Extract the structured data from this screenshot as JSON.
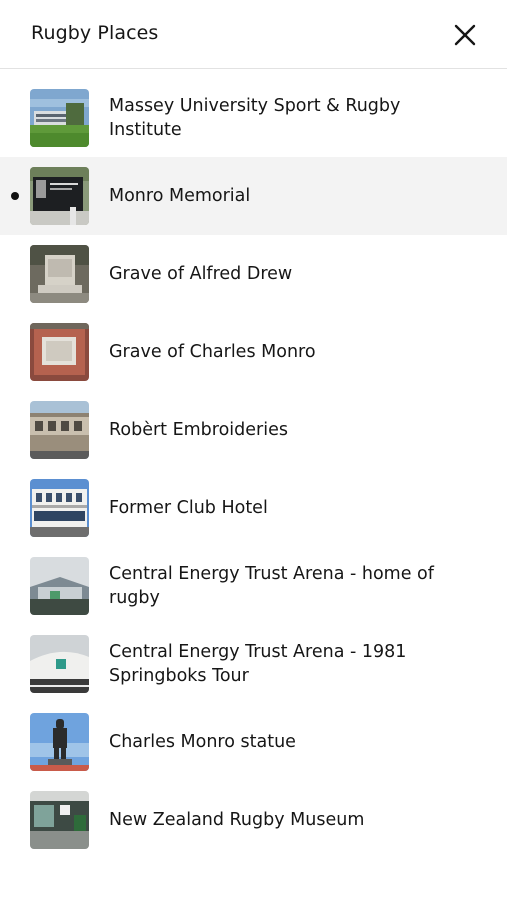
{
  "header": {
    "title": "Rugby Places",
    "close_icon": "close-icon"
  },
  "places": [
    {
      "name": "Massey University Sport & Rugby Institute",
      "active": false
    },
    {
      "name": "Monro Memorial",
      "active": true
    },
    {
      "name": "Grave of Alfred Drew",
      "active": false
    },
    {
      "name": "Grave of Charles Monro",
      "active": false
    },
    {
      "name": "Robèrt Embroideries",
      "active": false
    },
    {
      "name": "Former Club Hotel",
      "active": false
    },
    {
      "name": "Central Energy Trust Arena - home of rugby",
      "active": false
    },
    {
      "name": "Central Energy Trust Arena - 1981 Springboks Tour",
      "active": false
    },
    {
      "name": "Charles Monro statue",
      "active": false
    },
    {
      "name": "New Zealand Rugby Museum",
      "active": false
    }
  ]
}
